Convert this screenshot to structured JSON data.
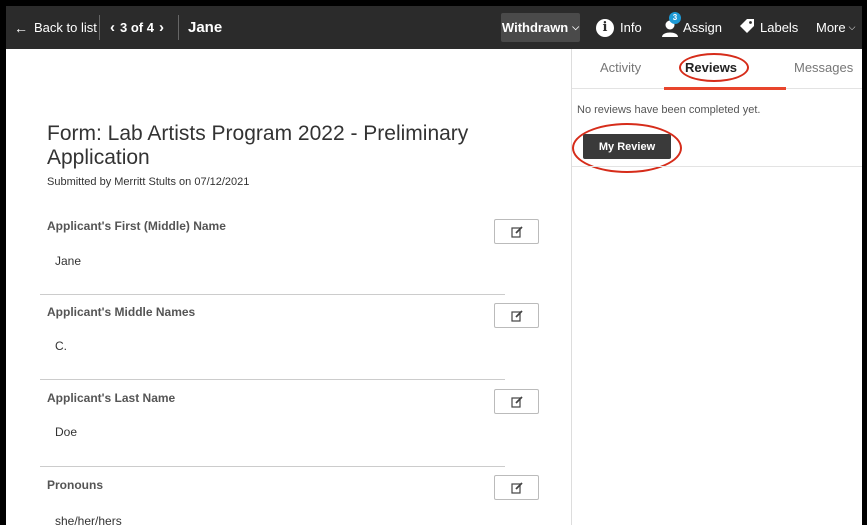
{
  "topbar": {
    "back_label": "Back to list",
    "pager": "3 of 4",
    "name": "Jane",
    "status": "Withdrawn",
    "info_label": "Info",
    "assign_label": "Assign",
    "assign_badge": "3",
    "labels_label": "Labels",
    "more_label": "More"
  },
  "form": {
    "title": "Form: Lab Artists Program 2022 - Preliminary Application",
    "submitted": "Submitted by Merritt Stults on 07/12/2021",
    "fields": [
      {
        "label": "Applicant's First (Middle) Name",
        "value": "Jane"
      },
      {
        "label": "Applicant's Middle Names",
        "value": "C."
      },
      {
        "label": "Applicant's Last Name",
        "value": "Doe"
      },
      {
        "label": "Pronouns",
        "value": "she/her/hers"
      }
    ]
  },
  "sidebar": {
    "tabs": [
      "Activity",
      "Reviews",
      "Messages"
    ],
    "active_tab": "Reviews",
    "empty_text": "No reviews have been completed yet.",
    "my_review_button": "My Review"
  },
  "colors": {
    "topbar_bg": "#2b2b2b",
    "accent": "#e8452c",
    "annotation": "#d62c1a",
    "badge": "#1e9ad6"
  }
}
